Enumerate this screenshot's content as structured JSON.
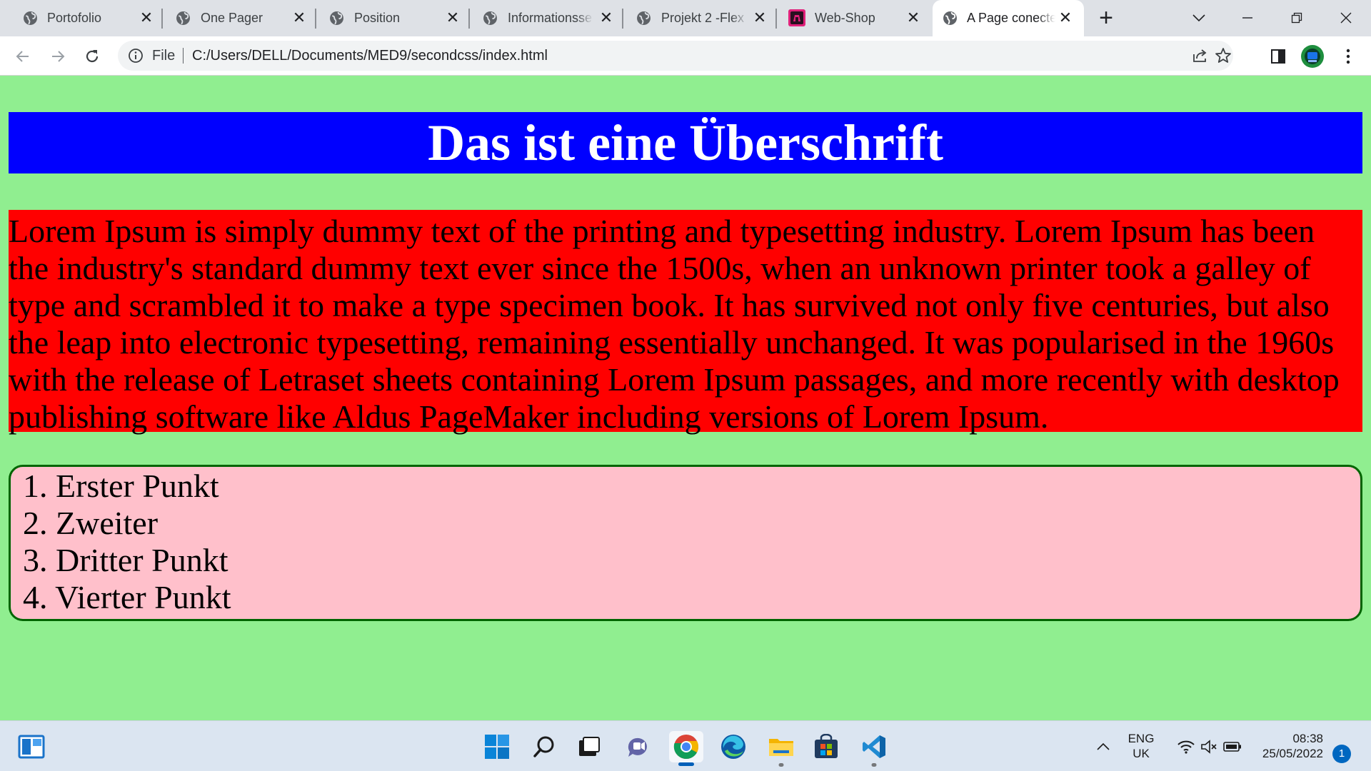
{
  "browser": {
    "tabs": [
      {
        "title": "Portofolio",
        "icon": "globe-icon"
      },
      {
        "title": "One Pager",
        "icon": "globe-icon"
      },
      {
        "title": "Position",
        "icon": "globe-icon"
      },
      {
        "title": "Informationsse",
        "icon": "globe-icon"
      },
      {
        "title": "Projekt 2 -Flex",
        "icon": "globe-icon"
      },
      {
        "title": "Web-Shop",
        "icon": "webshop-favicon-icon"
      },
      {
        "title": "A Page conecte",
        "icon": "globe-icon",
        "active": true
      }
    ],
    "omnibox": {
      "scheme_label": "File",
      "url": "C:/Users/DELL/Documents/MED9/secondcss/index.html"
    }
  },
  "page": {
    "heading": "Das ist eine Überschrift",
    "paragraph": "Lorem Ipsum is simply dummy text of the printing and typesetting industry. Lorem Ipsum has been the industry's standard dummy text ever since the 1500s, when an unknown printer took a galley of type and scrambled it to make a type specimen book. It has survived not only five centuries, but also the leap into electronic typesetting, remaining essentially unchanged. It was popularised in the 1960s with the release of Letraset sheets containing Lorem Ipsum passages, and more recently with desktop publishing software like Aldus PageMaker including versions of Lorem Ipsum.",
    "list": [
      "1. Erster Punkt",
      "2. Zweiter",
      "3. Dritter Punkt",
      "4. Vierter Punkt"
    ],
    "colors": {
      "background": "#90ee90",
      "heading_bg": "#0000ff",
      "paragraph_bg": "#ff0000",
      "list_bg": "#ffc0cb",
      "list_border": "#006400"
    }
  },
  "taskbar": {
    "language": "ENG",
    "region": "UK",
    "time": "08:38",
    "date": "25/05/2022",
    "notification_count": "1",
    "apps": [
      "start-icon",
      "search-icon",
      "task-view-icon",
      "chat-icon",
      "chrome-icon",
      "edge-icon",
      "file-explorer-icon",
      "store-icon",
      "vscode-icon"
    ]
  }
}
